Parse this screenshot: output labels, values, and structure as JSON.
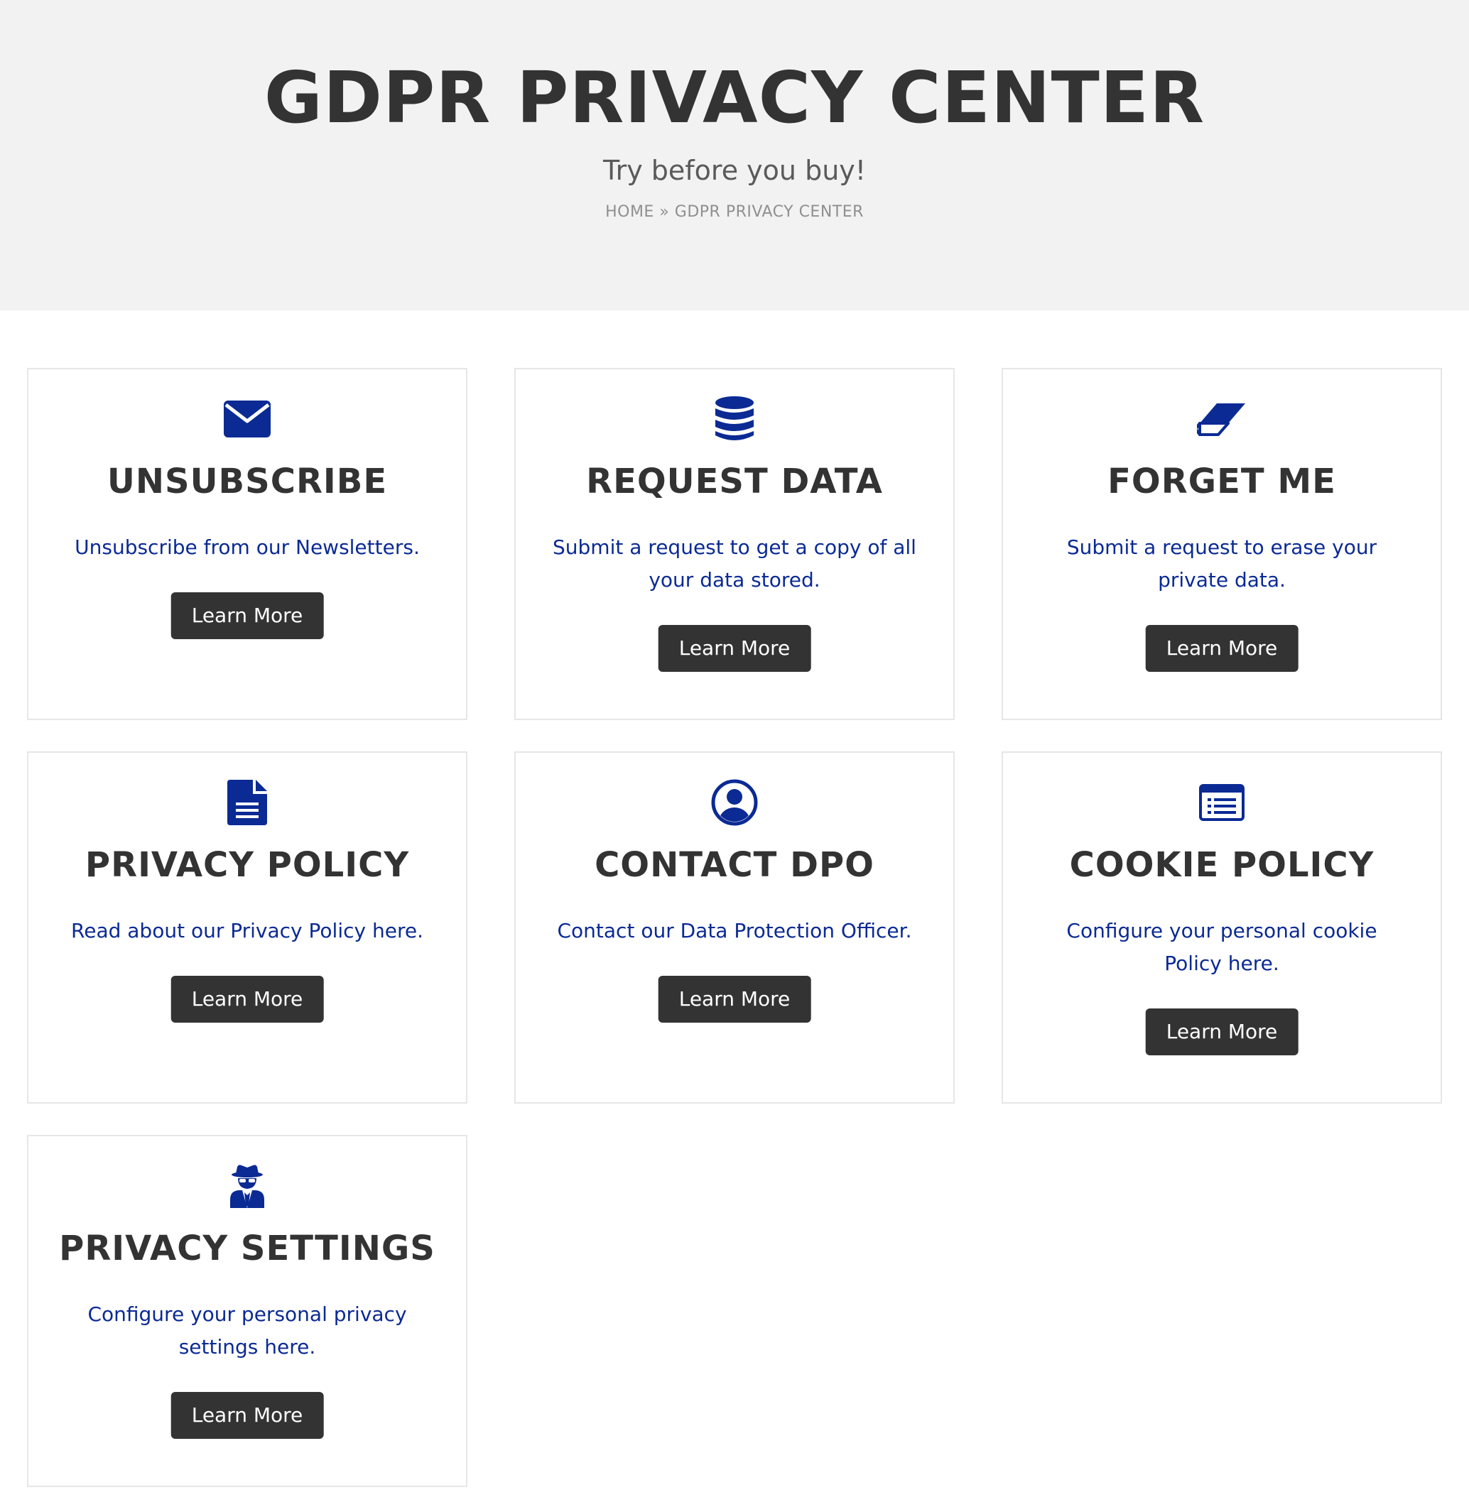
{
  "hero": {
    "title": "GDPR PRIVACY CENTER",
    "subtitle": "Try before you buy!",
    "breadcrumb": {
      "home": "HOME",
      "separator": " » ",
      "current": "GDPR PRIVACY CENTER"
    }
  },
  "colors": {
    "accent": "#0b2a94",
    "button": "#333333",
    "hero_bg": "#f2f2f2",
    "card_border": "#e6e6e6"
  },
  "cards": [
    {
      "icon": "envelope-icon",
      "title": "UNSUBSCRIBE",
      "description": "Unsubscribe from our Newsletters.",
      "button_label": "Learn More"
    },
    {
      "icon": "database-icon",
      "title": "REQUEST DATA",
      "description": "Submit a request to get a copy of all your data stored.",
      "button_label": "Learn More"
    },
    {
      "icon": "eraser-icon",
      "title": "FORGET ME",
      "description": "Submit a request to erase your private data.",
      "button_label": "Learn More"
    },
    {
      "icon": "document-icon",
      "title": "PRIVACY POLICY",
      "description": "Read about our Privacy Policy here.",
      "button_label": "Learn More"
    },
    {
      "icon": "user-circle-icon",
      "title": "CONTACT DPO",
      "description": "Contact our Data Protection Officer.",
      "button_label": "Learn More"
    },
    {
      "icon": "list-alt-icon",
      "title": "COOKIE POLICY",
      "description": "Configure your personal cookie Policy here.",
      "button_label": "Learn More"
    },
    {
      "icon": "user-secret-icon",
      "title": "PRIVACY SETTINGS",
      "description": "Configure your personal privacy settings here.",
      "button_label": "Learn More"
    }
  ]
}
